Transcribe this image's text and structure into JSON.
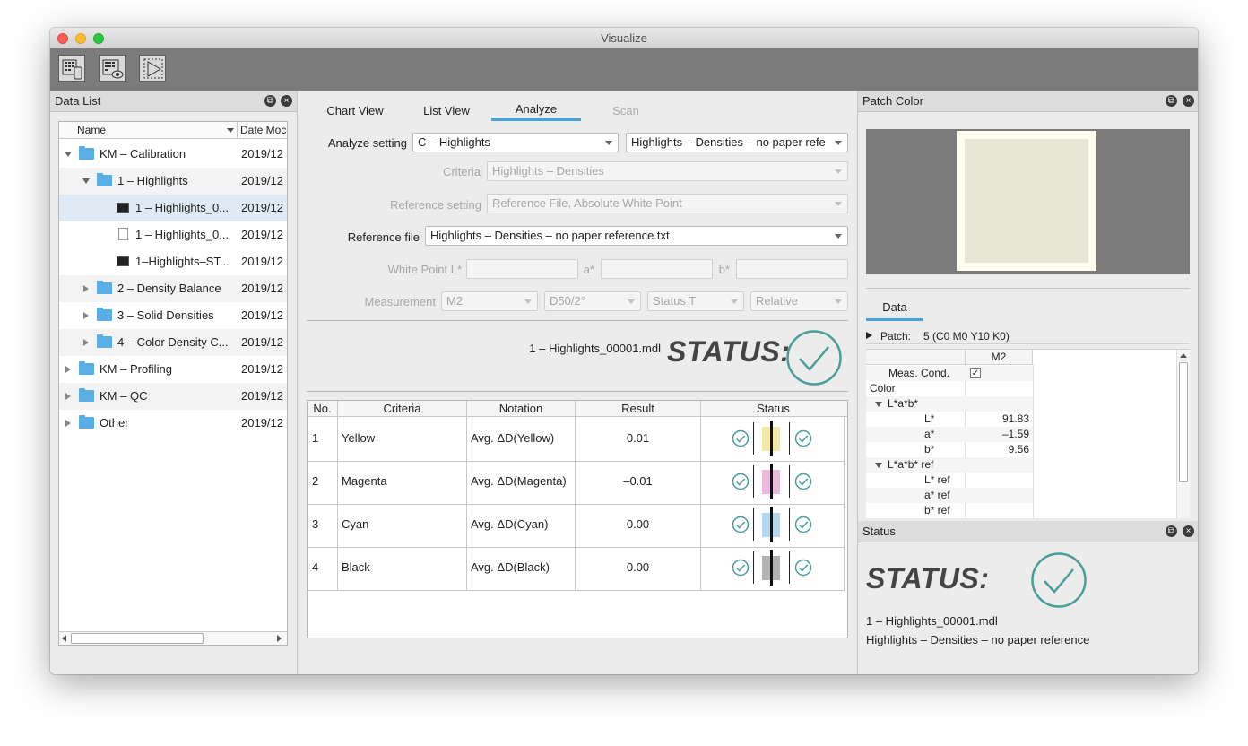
{
  "window": {
    "title": "Visualize"
  },
  "toolbar": {
    "buttons": [
      {
        "icon": "chart-device-icon"
      },
      {
        "icon": "chart-view-icon"
      },
      {
        "icon": "scan-icon"
      }
    ]
  },
  "data_list": {
    "title": "Data List",
    "columns": [
      "Name",
      "Date Moc"
    ],
    "rows": [
      {
        "name": "KM – Calibration",
        "date": "2019/12"
      },
      {
        "name": "1 – Highlights",
        "date": "2019/12"
      },
      {
        "name": "1 – Highlights_0...",
        "date": "2019/12"
      },
      {
        "name": "1 – Highlights_0...",
        "date": "2019/12"
      },
      {
        "name": "1–Highlights–ST...",
        "date": "2019/12"
      },
      {
        "name": "2 – Density Balance",
        "date": "2019/12"
      },
      {
        "name": "3 – Solid Densities",
        "date": "2019/12"
      },
      {
        "name": "4 – Color Density C...",
        "date": "2019/12"
      },
      {
        "name": "KM – Profiling",
        "date": "2019/12"
      },
      {
        "name": "KM – QC",
        "date": "2019/12"
      },
      {
        "name": "Other",
        "date": "2019/12"
      }
    ]
  },
  "tabs": [
    "Chart View",
    "List View",
    "Analyze",
    "Scan"
  ],
  "analyze": {
    "setting_label": "Analyze setting",
    "setting_value": "C – Highlights",
    "setting_value2": "Highlights – Densities – no paper refe",
    "criteria_label": "Criteria",
    "criteria_value": "Highlights – Densities",
    "reference_setting_label": "Reference setting",
    "reference_setting_value": "Reference File, Absolute White Point",
    "reference_file_label": "Reference file",
    "reference_file_value": "Highlights – Densities – no paper reference.txt",
    "white_point_label": "White Point  L*",
    "a_label": "a*",
    "b_label": "b*",
    "measurement_label": "Measurement",
    "measurement_values": [
      "M2",
      "D50/2°",
      "Status T",
      "Relative"
    ],
    "file_name": "1 – Highlights_00001.mdl",
    "status_label": "STATUS:"
  },
  "results": {
    "columns": [
      "No.",
      "Criteria",
      "Notation",
      "Result",
      "Status"
    ],
    "rows": [
      {
        "no": "1",
        "criteria": "Yellow",
        "notation": "Avg. ΔD(Yellow)",
        "result": "0.01",
        "color": "#f3e8a6"
      },
      {
        "no": "2",
        "criteria": "Magenta",
        "notation": "Avg. ΔD(Magenta)",
        "result": "–0.01",
        "color": "#eab9de"
      },
      {
        "no": "3",
        "criteria": "Cyan",
        "notation": "Avg. ΔD(Cyan)",
        "result": "0.00",
        "color": "#b5d8f0"
      },
      {
        "no": "4",
        "criteria": "Black",
        "notation": "Avg. ΔD(Black)",
        "result": "0.00",
        "color": "#b3b3b3"
      }
    ]
  },
  "patch_color": {
    "title": "Patch Color",
    "swatch_color": "#e8e6d4"
  },
  "data_tab": "Data",
  "patch": {
    "label": "Patch:",
    "value": "5 (C0 M0 Y10 K0)"
  },
  "data_table": {
    "column": "M2",
    "rows": [
      {
        "label": "Meas. Cond.",
        "value": "✓",
        "indent": 1
      },
      {
        "label": "Color",
        "value": "",
        "indent": 0
      },
      {
        "label": "L*a*b*",
        "value": "",
        "indent": 1
      },
      {
        "label": "L*",
        "value": "91.83",
        "indent": 2
      },
      {
        "label": "a*",
        "value": "–1.59",
        "indent": 2
      },
      {
        "label": "b*",
        "value": "9.56",
        "indent": 2
      },
      {
        "label": "L*a*b* ref",
        "value": "",
        "indent": 1
      },
      {
        "label": "L* ref",
        "value": "",
        "indent": 2
      },
      {
        "label": "a* ref",
        "value": "",
        "indent": 2
      },
      {
        "label": "b* ref",
        "value": "",
        "indent": 2
      }
    ]
  },
  "status_panel": {
    "title": "Status",
    "status_label": "STATUS:",
    "file": "1 – Highlights_00001.mdl",
    "setting": "Highlights – Densities – no paper reference"
  },
  "colors": {
    "accent": "#4aa3d8",
    "ok_teal": "#4a9e9a"
  }
}
